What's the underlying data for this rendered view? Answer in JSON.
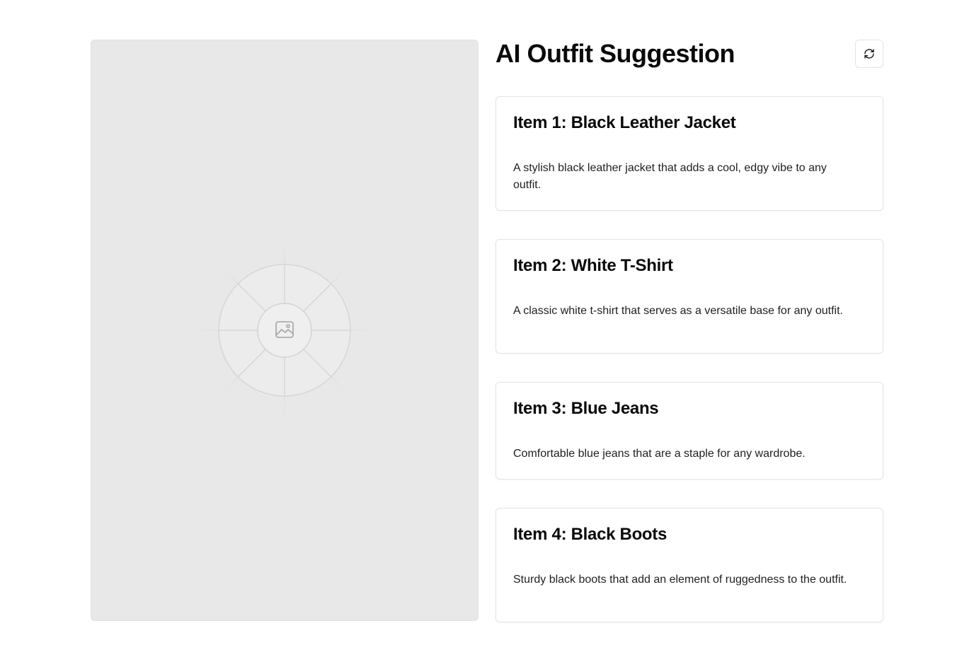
{
  "page": {
    "title": "AI Outfit Suggestion"
  },
  "image_panel": {
    "icon": "image-placeholder-icon",
    "background": "#e8e8e8"
  },
  "toolbar": {
    "refresh_icon": "refresh-icon"
  },
  "items": [
    {
      "title": "Item 1: Black Leather Jacket",
      "description": "A stylish black leather jacket that adds a cool, edgy vibe to any outfit."
    },
    {
      "title": "Item 2: White T-Shirt",
      "description": "A classic white t-shirt that serves as a versatile base for any outfit."
    },
    {
      "title": "Item 3: Blue Jeans",
      "description": "Comfortable blue jeans that are a staple for any wardrobe."
    },
    {
      "title": "Item 4: Black Boots",
      "description": "Sturdy black boots that add an element of ruggedness to the outfit."
    }
  ],
  "colors": {
    "text": "#0a0a0a",
    "border": "#e4e4e7",
    "panel": "#e8e8e8"
  }
}
